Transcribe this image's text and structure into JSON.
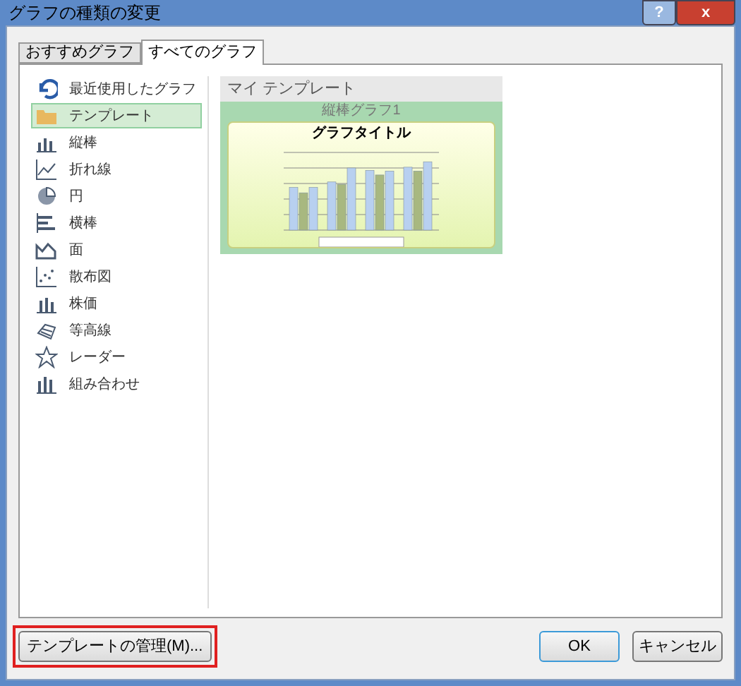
{
  "window": {
    "title": "グラフの種類の変更",
    "buttons": [
      {
        "kind": "help",
        "label": "?"
      },
      {
        "kind": "close",
        "label": "x"
      }
    ]
  },
  "tabs": [
    {
      "label": "おすすめグラフ",
      "selected": false
    },
    {
      "label": "すべてのグラフ",
      "selected": true
    }
  ],
  "sidebar": {
    "items": [
      {
        "label": "最近使用したグラフ",
        "kind": "recent",
        "selected": false
      },
      {
        "label": "テンプレート",
        "kind": "folder",
        "selected": true
      },
      {
        "label": "縦棒",
        "kind": "column",
        "selected": false
      },
      {
        "label": "折れ線",
        "kind": "line",
        "selected": false
      },
      {
        "label": "円",
        "kind": "pie",
        "selected": false
      },
      {
        "label": "横棒",
        "kind": "bar",
        "selected": false
      },
      {
        "label": "面",
        "kind": "area",
        "selected": false
      },
      {
        "label": "散布図",
        "kind": "scatter",
        "selected": false
      },
      {
        "label": "株価",
        "kind": "stock",
        "selected": false
      },
      {
        "label": "等高線",
        "kind": "surface",
        "selected": false
      },
      {
        "label": "レーダー",
        "kind": "radar",
        "selected": false
      },
      {
        "label": "組み合わせ",
        "kind": "combo",
        "selected": false
      }
    ]
  },
  "section": {
    "title": "マイ テンプレート",
    "templates": [
      {
        "name": "縦棒グラフ1",
        "chart_title": "グラフタイトル",
        "selected": true
      }
    ]
  },
  "footer": {
    "manage_button": {
      "label": "テンプレートの管理(M)...",
      "highlighted": true
    },
    "buttons": [
      {
        "label": "OK",
        "default": true
      },
      {
        "label": "キャンセル",
        "default": false
      }
    ]
  }
}
